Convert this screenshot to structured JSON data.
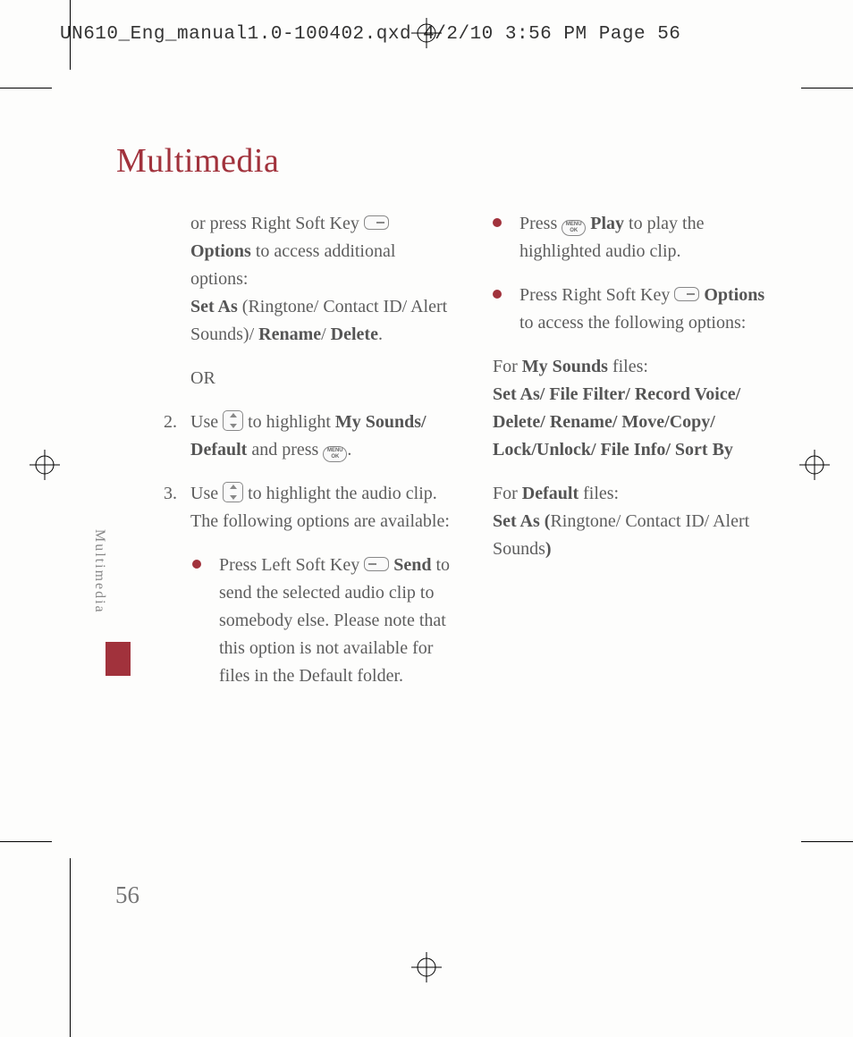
{
  "header": "UN610_Eng_manual1.0-100402.qxd  4/2/10  3:56 PM  Page 56",
  "title": "Multimedia",
  "sidebar_label": "Multimedia",
  "page_number": "56",
  "icon_ok_label": "MENU\nOK",
  "col1": {
    "p1_a": "or press Right Soft Key ",
    "p1_b_bold": "Options",
    "p1_c": " to access additional options:",
    "p1_d_bold": "Set As",
    "p1_e": " (Ringtone/ Contact ID/ Alert Sounds)/ ",
    "p1_f_bold": "Rename",
    "p1_g": "/ ",
    "p1_h_bold": "Delete",
    "p1_i": ".",
    "or": "OR",
    "step2_num": "2.",
    "step2_a": "Use ",
    "step2_b": " to highlight ",
    "step2_c_bold": "My Sounds/ Default",
    "step2_d": " and press ",
    "step2_e": ".",
    "step3_num": "3.",
    "step3_a": "Use ",
    "step3_b": " to highlight the audio clip. The following options are available:",
    "b1_a": "Press Left Soft Key ",
    "b1_b_bold": "Send",
    "b1_c": " to send the selected audio clip to somebody else. Please note that this option is not available for files in the Default folder."
  },
  "col2": {
    "b2_a": "Press ",
    "b2_b_bold": "Play",
    "b2_c": " to play the highlighted audio clip.",
    "b3_a": "Press Right Soft Key ",
    "b3_b_bold": "Options",
    "b3_c": " to access the following options:",
    "my_a": "For ",
    "my_b_bold": "My Sounds",
    "my_c": " files:",
    "my_list_bold": "Set As/ File Filter/ Record Voice/ Delete/ Rename/ Move/Copy/ Lock/Unlock/ File Info/ Sort By",
    "def_a": "For ",
    "def_b_bold": "Default",
    "def_c": " files:",
    "def_d_bold": "Set As (",
    "def_e": "Ringtone/ Contact ID/ Alert Sounds",
    "def_f_bold": ")"
  }
}
